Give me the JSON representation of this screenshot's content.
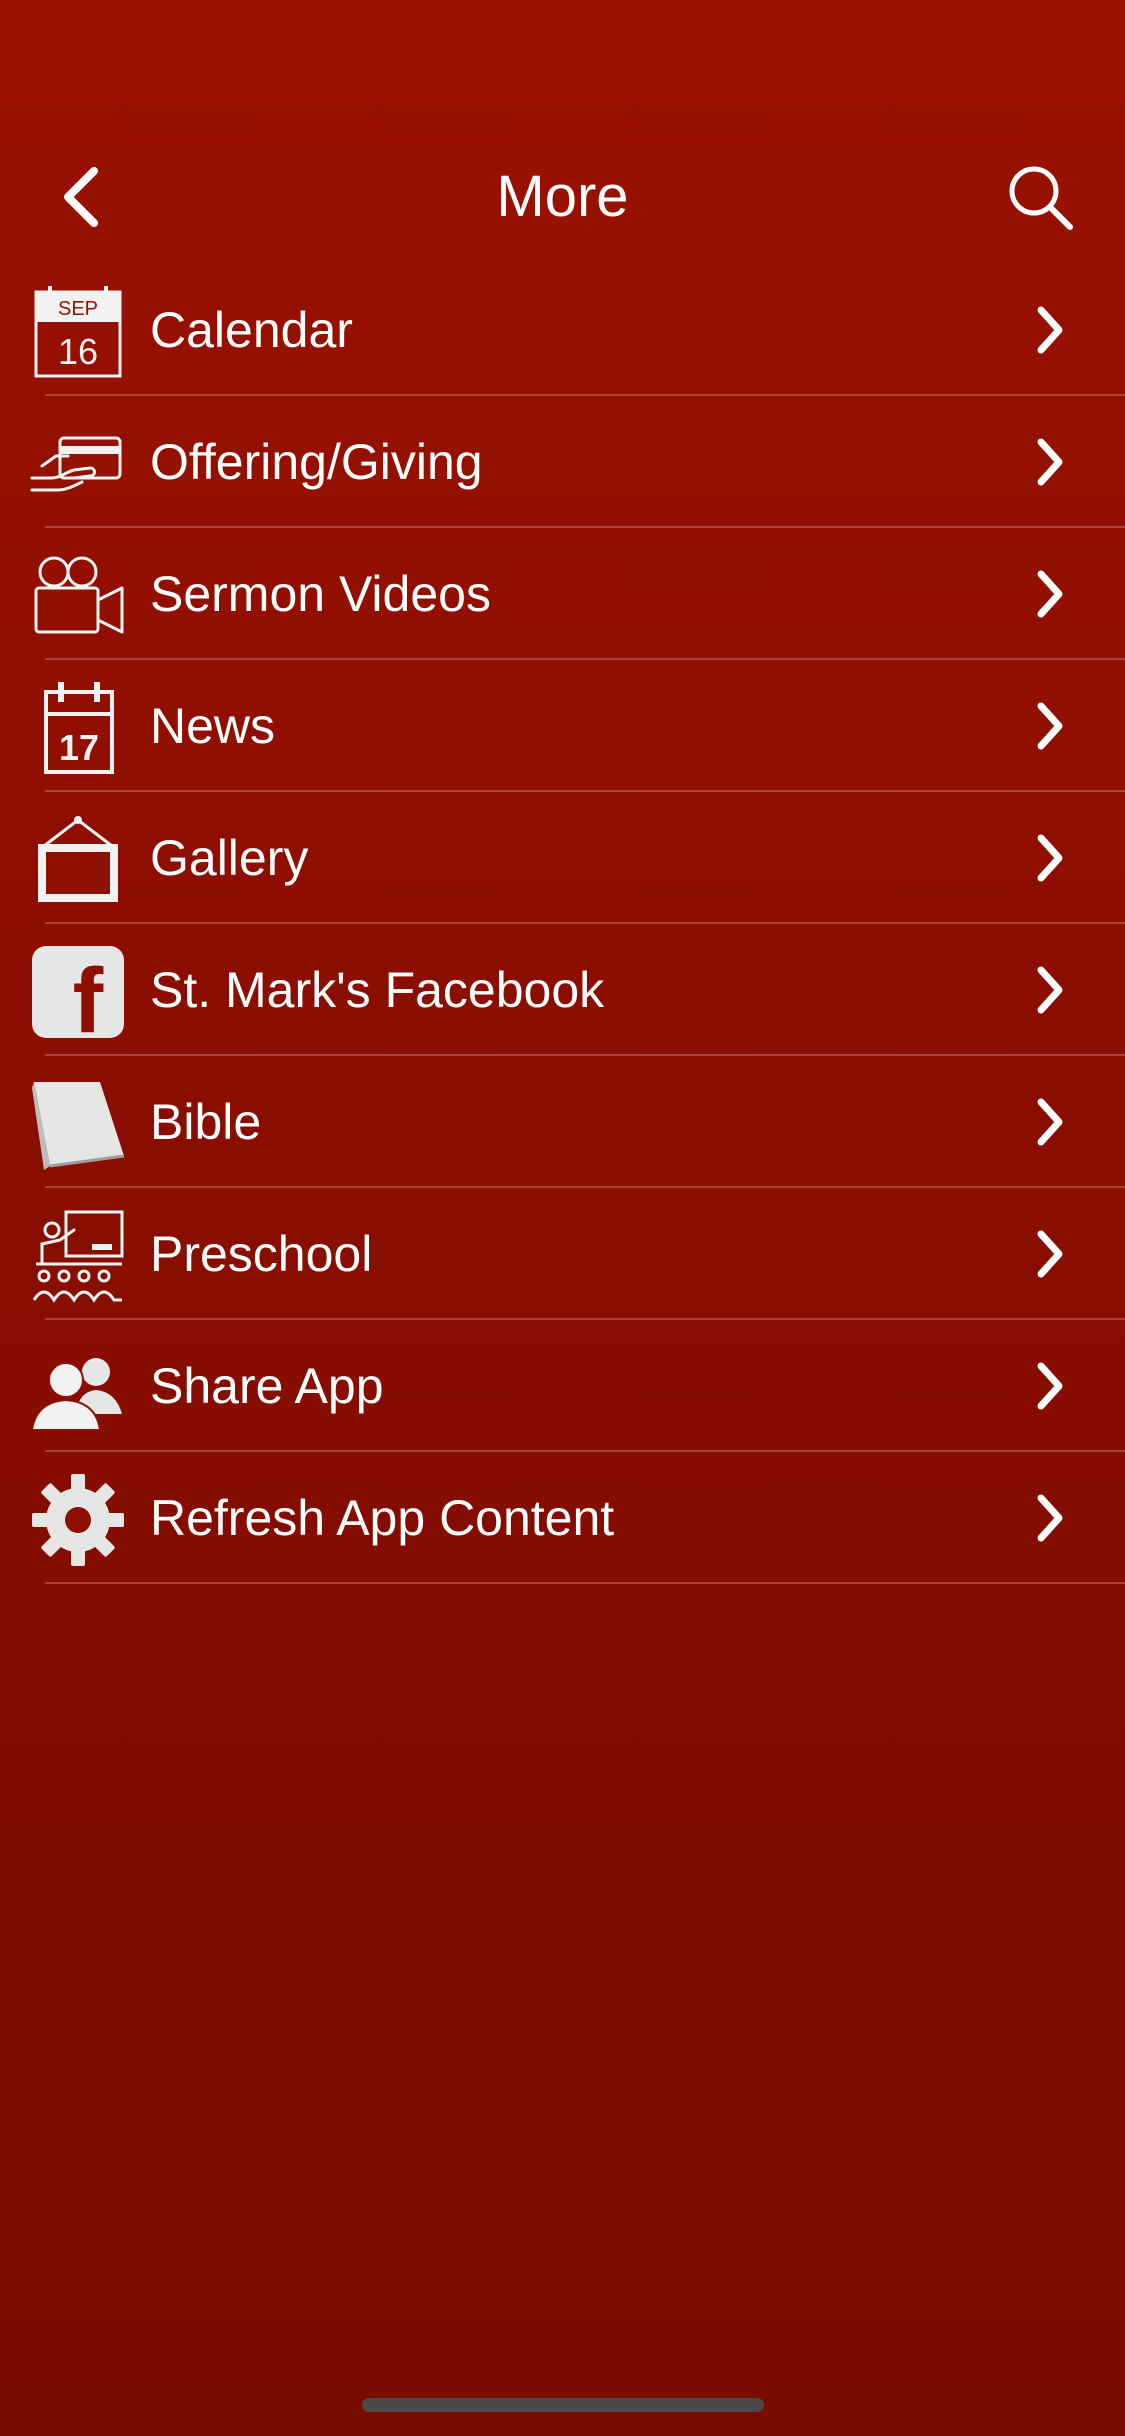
{
  "nav": {
    "title": "More",
    "back_icon": "chevron-left-icon",
    "search_icon": "magnifier-icon"
  },
  "menu": {
    "items": [
      {
        "label": "Calendar",
        "icon": "calendar-sep-16-icon",
        "icon_text_top": "SEP",
        "icon_text_bottom": "16"
      },
      {
        "label": "Offering/Giving",
        "icon": "hand-card-icon"
      },
      {
        "label": "Sermon Videos",
        "icon": "video-camera-icon"
      },
      {
        "label": "News",
        "icon": "calendar-17-icon",
        "icon_text_bottom": "17"
      },
      {
        "label": "Gallery",
        "icon": "picture-frame-icon"
      },
      {
        "label": "St. Mark's Facebook",
        "icon": "facebook-icon",
        "icon_text_bottom": "f"
      },
      {
        "label": "Bible",
        "icon": "book-icon"
      },
      {
        "label": "Preschool",
        "icon": "classroom-icon"
      },
      {
        "label": "Share App",
        "icon": "people-icon"
      },
      {
        "label": "Refresh App Content",
        "icon": "gear-icon"
      }
    ]
  },
  "colors": {
    "background_top": "#9b1100",
    "background_bottom": "#7a0b00",
    "text": "#ffffff",
    "home_indicator": "#4a4a4a"
  }
}
